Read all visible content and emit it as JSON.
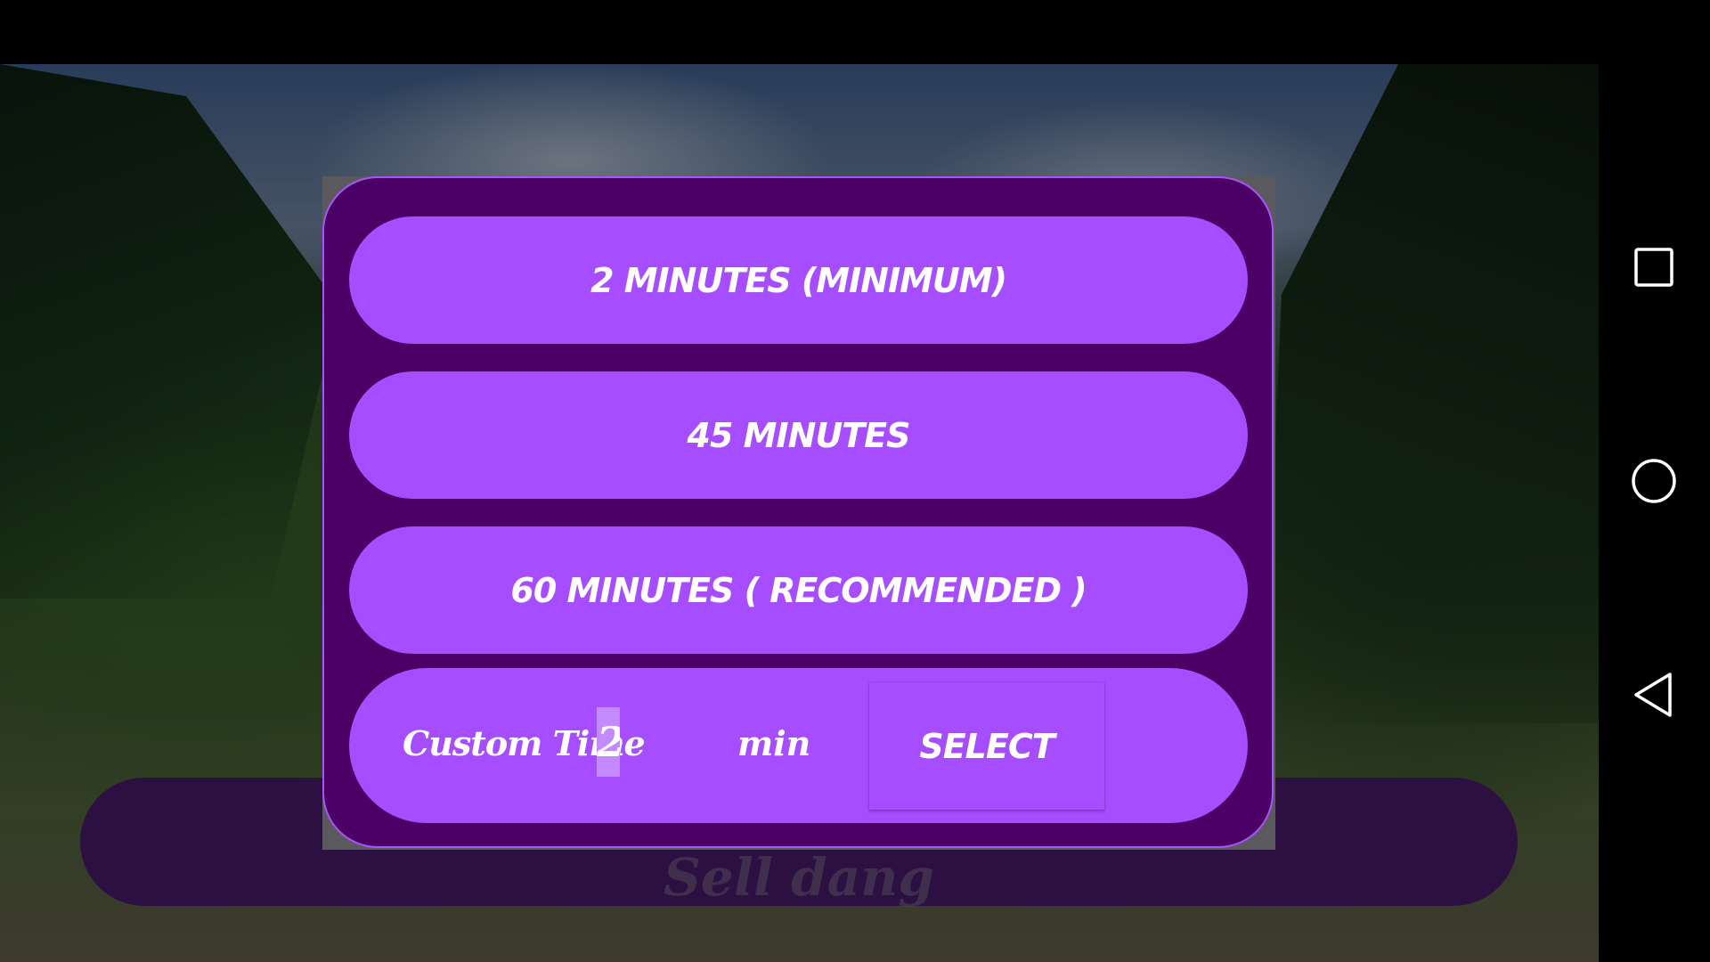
{
  "dialog": {
    "options": [
      {
        "label": "2 MINUTES (MINIMUM)"
      },
      {
        "label": "45 MINUTES"
      },
      {
        "label": "60 MINUTES ( RECOMMENDED )"
      }
    ],
    "custom": {
      "label": "Custom Time",
      "value": "2",
      "unit": "min",
      "select_label": "SELECT"
    }
  },
  "underlying": {
    "button_label": "Sell dang"
  },
  "colors": {
    "dialog_background": "#4a0064",
    "option_background": "#a64dff",
    "dialog_border": "#a855f7",
    "underlying_button": "#4a1d70"
  },
  "nav_icons": [
    "recent-apps-icon",
    "home-icon",
    "back-icon"
  ]
}
